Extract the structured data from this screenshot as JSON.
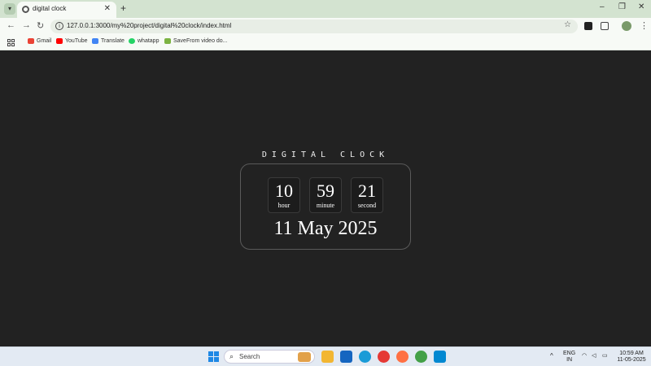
{
  "browser": {
    "tab_title": "digital clock",
    "url": "127.0.0.1:3000/my%20project/digital%20clock/index.html",
    "bookmarks": [
      {
        "label": "Gmail",
        "icon": "gmail-icon",
        "color": "#ea4335"
      },
      {
        "label": "YouTube",
        "icon": "youtube-icon",
        "color": "#ff0000"
      },
      {
        "label": "Translate",
        "icon": "translate-icon",
        "color": "#4285f4"
      },
      {
        "label": "whatapp",
        "icon": "whatsapp-icon",
        "color": "#25d366"
      },
      {
        "label": "SaveFrom video do...",
        "icon": "savefrom-icon",
        "color": "#7cb342"
      }
    ]
  },
  "clock": {
    "title": "DIGITAL CLOCK",
    "hour": "10",
    "hour_label": "hour",
    "minute": "59",
    "minute_label": "minute",
    "second": "21",
    "second_label": "second",
    "date": "11 May 2025"
  },
  "taskbar": {
    "search_placeholder": "Search",
    "lang_top": "ENG",
    "lang_bottom": "IN",
    "time": "10:59 AM",
    "date": "11-05-2025"
  },
  "colors": {
    "page_bg": "#222222",
    "tabstrip_bg": "#d3e3d0",
    "clock_border": "#5a5a5a"
  }
}
